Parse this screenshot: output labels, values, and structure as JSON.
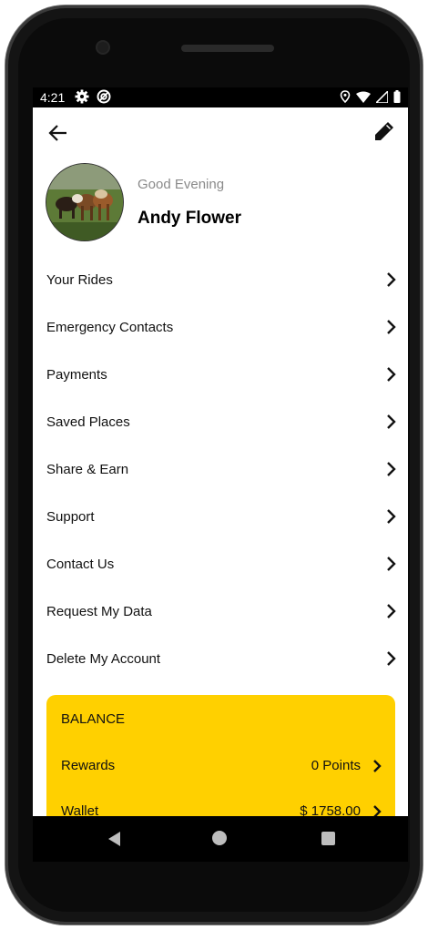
{
  "status_bar": {
    "time": "4:21"
  },
  "profile": {
    "greeting": "Good Evening",
    "name": "Andy Flower"
  },
  "menu": [
    {
      "label": "Your Rides"
    },
    {
      "label": "Emergency Contacts"
    },
    {
      "label": "Payments"
    },
    {
      "label": "Saved Places"
    },
    {
      "label": "Share & Earn"
    },
    {
      "label": "Support"
    },
    {
      "label": "Contact Us"
    },
    {
      "label": "Request My Data"
    },
    {
      "label": "Delete My Account"
    }
  ],
  "balance": {
    "title": "BALANCE",
    "rewards_label": "Rewards",
    "rewards_value": "0 Points",
    "wallet_label": "Wallet",
    "wallet_value": "$ 1758.00"
  },
  "icons": {
    "status_left": [
      "gear-icon",
      "sync-icon"
    ],
    "status_right": [
      "location-icon",
      "wifi-icon",
      "signal-icon",
      "battery-icon"
    ],
    "appbar": [
      "back-arrow-icon",
      "pencil-icon"
    ],
    "nav": [
      "nav-back-icon",
      "nav-home-icon",
      "nav-recents-icon"
    ]
  },
  "colors": {
    "accent": "#FFD000",
    "text": "#111111",
    "muted": "#8a8a8a"
  }
}
